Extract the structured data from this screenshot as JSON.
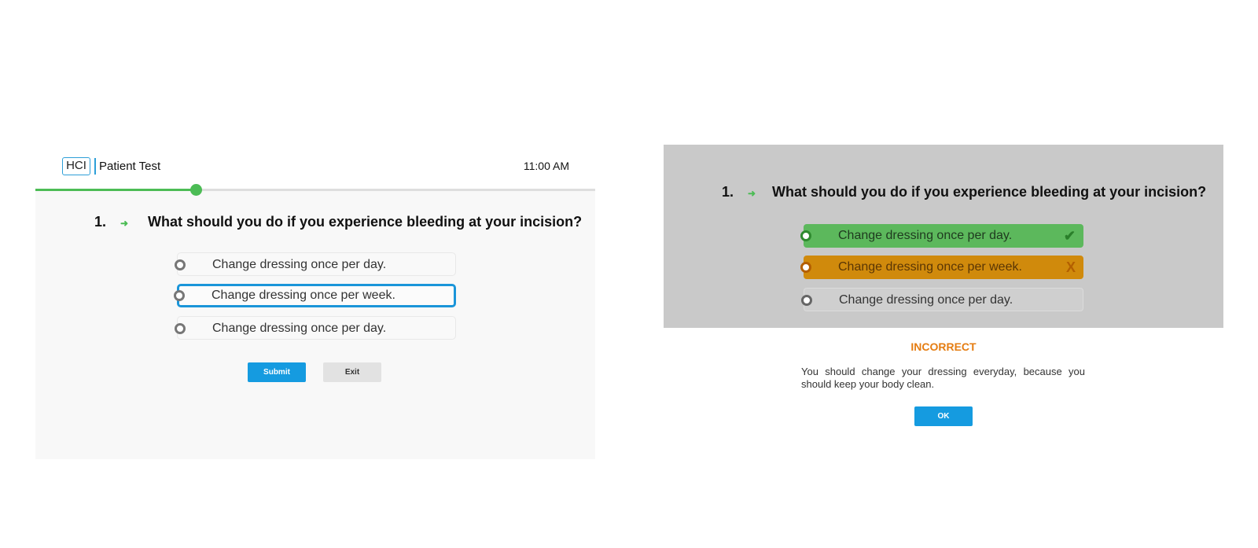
{
  "header": {
    "logo_text": "HCI",
    "app_title": "Patient Test",
    "time": "11:00 AM"
  },
  "progress": {
    "fraction": 0.286
  },
  "question": {
    "number": "1.",
    "arrow": "➜",
    "text": "What should you do if you experience bleeding at your incision?"
  },
  "options": [
    {
      "label": "Change dressing once per day."
    },
    {
      "label": "Change dressing once per week."
    },
    {
      "label": "Change dressing once per day."
    }
  ],
  "selected_index": 1,
  "buttons": {
    "submit": "Submit",
    "exit": "Exit",
    "ok": "OK"
  },
  "feedback": {
    "options": [
      {
        "label": "Change dressing once per day.",
        "state": "correct",
        "mark": "✔"
      },
      {
        "label": "Change dressing once per week.",
        "state": "incorrect",
        "mark": "X"
      },
      {
        "label": "Change dressing once per day.",
        "state": "neutral",
        "mark": ""
      }
    ],
    "result": "INCORRECT",
    "explanation": "You should change your dressing everyday, because you should keep your body clean."
  },
  "colors": {
    "accent_blue": "#159be0",
    "progress_green": "#4cbc55",
    "correct_green": "#5cb85c",
    "incorrect_orange": "#d08a0c",
    "result_orange": "#e57d12"
  },
  "icons": {
    "arrow": "arrow-right-icon",
    "check": "check-icon",
    "cross": "x-mark-icon"
  }
}
